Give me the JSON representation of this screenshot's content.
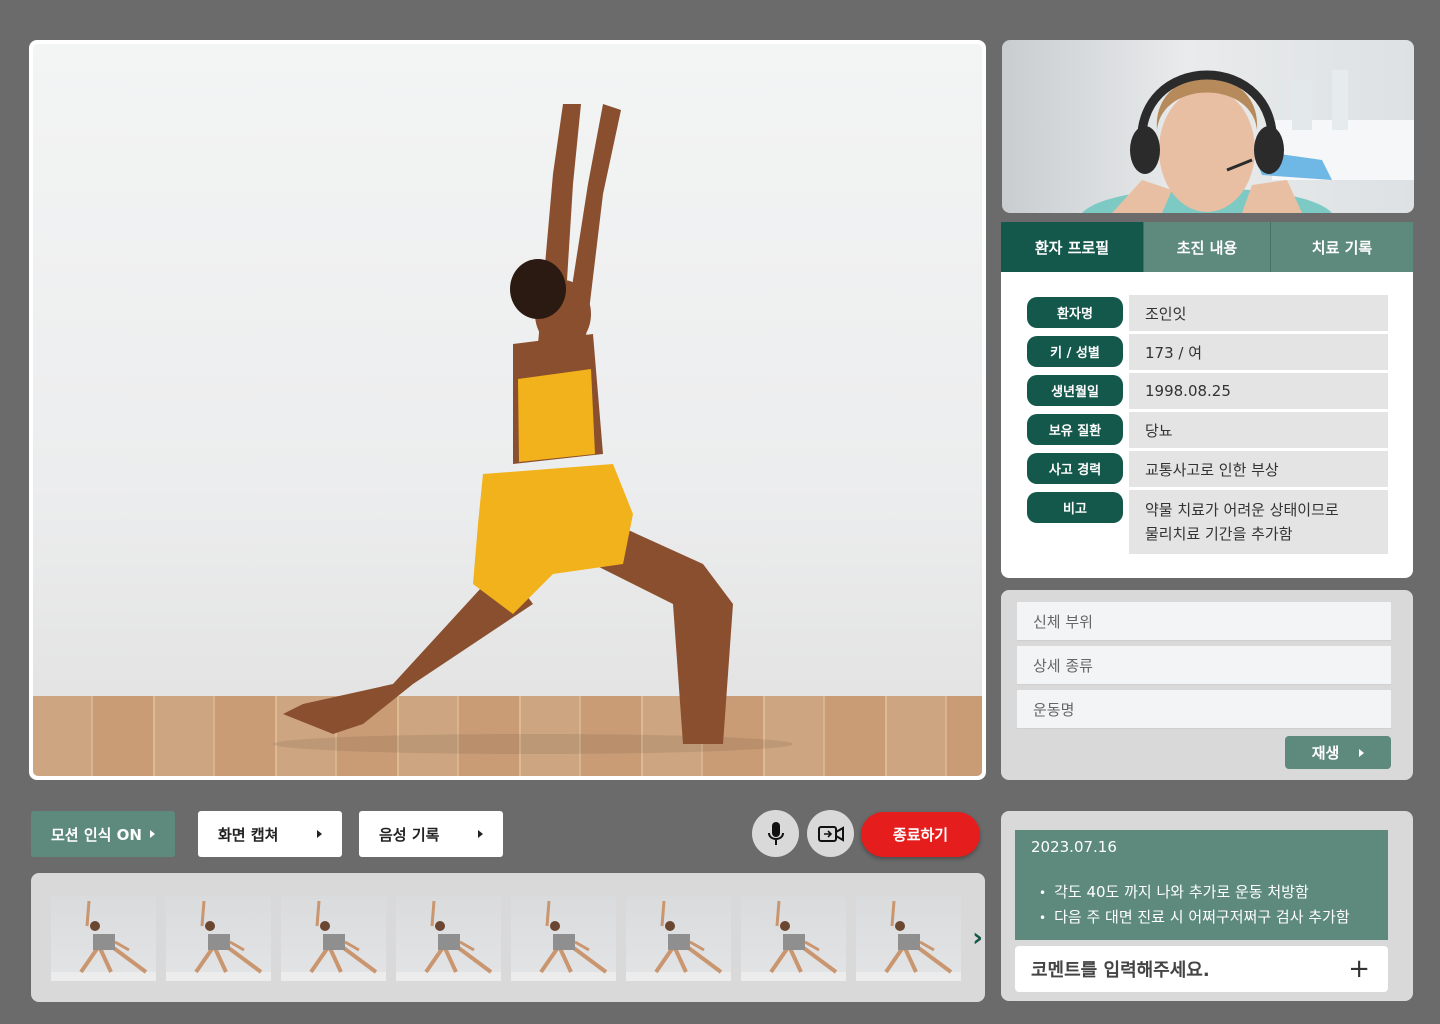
{
  "tabs": {
    "profile": "환자 프로필",
    "initial": "초진 내용",
    "records": "치료 기록"
  },
  "patient": {
    "name_label": "환자명",
    "name": "조인잇",
    "height_label": "키 / 성별",
    "height": "173 / 여",
    "birth_label": "생년월일",
    "birth": "1998.08.25",
    "disease_label": "보유 질환",
    "disease": "당뇨",
    "accident_label": "사고 경력",
    "accident": "교통사고로 인한 부상",
    "note_label": "비고",
    "note_line1": "약물 치료가 어려운 상태이므로",
    "note_line2": "물리치료 기간을 추가함"
  },
  "filter": {
    "body_part": "신체 부위",
    "detail_type": "상세 종류",
    "exercise_name": "운동명",
    "play": "재생"
  },
  "controls": {
    "motion": "모션 인식 ON",
    "capture": "화면 캡쳐",
    "voice": "음성 기록",
    "end": "종료하기",
    "mic_icon": "microphone-icon",
    "cam_icon": "camera-switch-icon"
  },
  "thumbnails": [
    "thumb-1",
    "thumb-2",
    "thumb-3",
    "thumb-4",
    "thumb-5",
    "thumb-6",
    "thumb-7",
    "thumb-8"
  ],
  "notes": {
    "date": "2023.07.16",
    "items": [
      "각도 40도 까지 나와 추가로 운동 처방함",
      "다음 주 대면 진료 시 어쩌구저쩌구 검사 추가함"
    ],
    "comment_placeholder": "코멘트를 입력해주세요.",
    "add_icon": "plus-icon"
  },
  "colors": {
    "background": "#6b6b6b",
    "primary_dark": "#14574b",
    "primary": "#5d8a7c",
    "danger": "#e61d1d"
  }
}
